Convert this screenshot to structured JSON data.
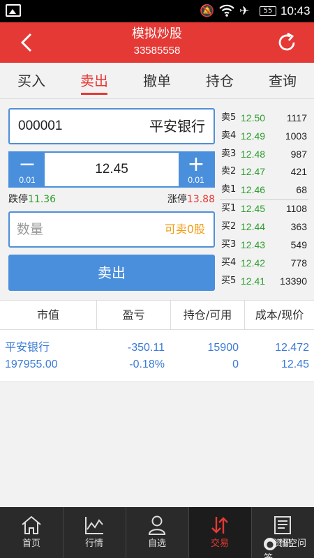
{
  "status_bar": {
    "battery": "55",
    "time": "10:43"
  },
  "header": {
    "title": "模拟炒股",
    "account": "33585558"
  },
  "tabs": [
    {
      "label": "买入",
      "active": false
    },
    {
      "label": "卖出",
      "active": true
    },
    {
      "label": "撤单",
      "active": false
    },
    {
      "label": "持仓",
      "active": false
    },
    {
      "label": "查询",
      "active": false
    }
  ],
  "form": {
    "stock_code": "000001",
    "stock_name": "平安银行",
    "price": "12.45",
    "step_minus": "0.01",
    "step_plus": "0.01",
    "limit_down_label": "跌停",
    "limit_down_value": "11.36",
    "limit_up_label": "涨停",
    "limit_up_value": "13.88",
    "quantity_placeholder": "数量",
    "available": "可卖0股",
    "submit_label": "卖出"
  },
  "order_book": {
    "asks": [
      {
        "label": "卖5",
        "price": "12.50",
        "volume": "1117"
      },
      {
        "label": "卖4",
        "price": "12.49",
        "volume": "1003"
      },
      {
        "label": "卖3",
        "price": "12.48",
        "volume": "987"
      },
      {
        "label": "卖2",
        "price": "12.47",
        "volume": "421"
      },
      {
        "label": "卖1",
        "price": "12.46",
        "volume": "68"
      }
    ],
    "bids": [
      {
        "label": "买1",
        "price": "12.45",
        "volume": "1108"
      },
      {
        "label": "买2",
        "price": "12.44",
        "volume": "363"
      },
      {
        "label": "买3",
        "price": "12.43",
        "volume": "549"
      },
      {
        "label": "买4",
        "price": "12.42",
        "volume": "778"
      },
      {
        "label": "买5",
        "price": "12.41",
        "volume": "13390"
      }
    ]
  },
  "positions": {
    "headers": [
      "市值",
      "盈亏",
      "持仓/可用",
      "成本/现价"
    ],
    "rows": [
      {
        "name": "平安银行",
        "market_value": "197955.00",
        "pnl": "-350.11",
        "pnl_pct": "-0.18%",
        "holding": "15900",
        "available": "0",
        "cost": "12.472",
        "current": "12.45"
      }
    ]
  },
  "bottom_nav": [
    {
      "label": "首页",
      "icon": "home-icon",
      "active": false
    },
    {
      "label": "行情",
      "icon": "chart-icon",
      "active": false
    },
    {
      "label": "自选",
      "icon": "user-icon",
      "active": false
    },
    {
      "label": "交易",
      "icon": "trade-icon",
      "active": true
    },
    {
      "label": "资讯",
      "icon": "news-icon",
      "active": false
    }
  ],
  "watermark": "悟空问答",
  "colors": {
    "brand": "#e53935",
    "accent": "#4a8fdc",
    "down": "#2e9e2e",
    "available": "#f39c12"
  }
}
